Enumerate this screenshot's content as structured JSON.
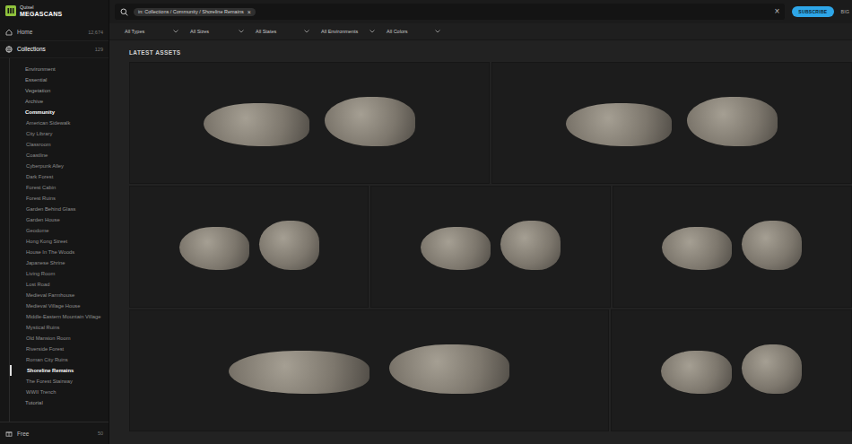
{
  "logo": {
    "brand": "Quixel",
    "product": "MEGASCANS"
  },
  "nav": [
    {
      "label": "Home",
      "count": "12,674",
      "selected": false
    },
    {
      "label": "Collections",
      "count": "129",
      "selected": true
    }
  ],
  "categories": [
    {
      "label": "Environment",
      "expanded": false,
      "children": []
    },
    {
      "label": "Essential",
      "expanded": false,
      "children": []
    },
    {
      "label": "Vegetation",
      "expanded": false,
      "children": []
    },
    {
      "label": "Archive",
      "expanded": false,
      "children": []
    },
    {
      "label": "Community",
      "expanded": true,
      "children": [
        {
          "label": "American Sidewalk",
          "selected": false
        },
        {
          "label": "City Library",
          "selected": false
        },
        {
          "label": "Classroom",
          "selected": false
        },
        {
          "label": "Coastline",
          "selected": false
        },
        {
          "label": "Cyberpunk Alley",
          "selected": false
        },
        {
          "label": "Dark Forest",
          "selected": false
        },
        {
          "label": "Forest Cabin",
          "selected": false
        },
        {
          "label": "Forest Ruins",
          "selected": false
        },
        {
          "label": "Garden Behind Glass",
          "selected": false
        },
        {
          "label": "Garden House",
          "selected": false
        },
        {
          "label": "Geodome",
          "selected": false
        },
        {
          "label": "Hong Kong Street",
          "selected": false
        },
        {
          "label": "House In The Woods",
          "selected": false
        },
        {
          "label": "Japanese Shrine",
          "selected": false
        },
        {
          "label": "Living Room",
          "selected": false
        },
        {
          "label": "Lost Road",
          "selected": false
        },
        {
          "label": "Medieval Farmhouse",
          "selected": false
        },
        {
          "label": "Medieval Village House",
          "selected": false
        },
        {
          "label": "Middle-Eastern Mountain Village",
          "selected": false
        },
        {
          "label": "Mystical Ruins",
          "selected": false
        },
        {
          "label": "Old Mansion Room",
          "selected": false
        },
        {
          "label": "Riverside Forest",
          "selected": false
        },
        {
          "label": "Roman City Ruins",
          "selected": false
        },
        {
          "label": "Shoreline Remains",
          "selected": true
        },
        {
          "label": "The Forest Stairway",
          "selected": false
        },
        {
          "label": "WWII Trench",
          "selected": false
        }
      ]
    },
    {
      "label": "Tutorial",
      "expanded": false,
      "children": []
    }
  ],
  "footer": {
    "label": "Free",
    "count": "50"
  },
  "search": {
    "chip": "in: Collections / Community / Shoreline Remains",
    "chip_close": "×",
    "clear": "×"
  },
  "subscribe": "SUBSCRIBE",
  "user": "BIG",
  "filters": [
    "All Types",
    "All Sizes",
    "All States",
    "All Environments",
    "All Colors"
  ],
  "section_title": "LATEST ASSETS",
  "asset_rows": [
    [
      {},
      {}
    ],
    [
      {},
      {},
      {}
    ],
    [
      {},
      {}
    ]
  ]
}
